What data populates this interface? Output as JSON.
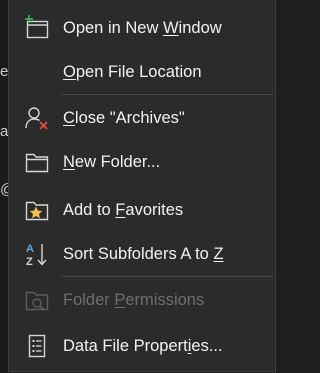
{
  "background_fragments": [
    "e",
    "a",
    "@"
  ],
  "menu": {
    "items": [
      {
        "pre": "Open in New ",
        "key": "W",
        "post": "indow",
        "icon": "new-window-icon"
      },
      {
        "pre": "",
        "key": "O",
        "post": "pen File Location",
        "icon": ""
      },
      {
        "pre": "",
        "key": "C",
        "post": "lose \"Archives\"",
        "icon": "person-remove-icon"
      },
      {
        "pre": "",
        "key": "N",
        "post": "ew Folder...",
        "icon": "folder-icon"
      },
      {
        "pre": "Add to ",
        "key": "F",
        "post": "avorites",
        "icon": "star-folder-icon"
      },
      {
        "pre": "Sort Subfolders A to ",
        "key": "Z",
        "post": "",
        "icon": "sort-az-icon"
      },
      {
        "pre": "Folder ",
        "key": "P",
        "post": "ermissions",
        "icon": "folder-permissions-icon",
        "disabled": true
      },
      {
        "pre": "Data File Propert",
        "key": "i",
        "post": "es...",
        "icon": "properties-icon"
      }
    ]
  }
}
